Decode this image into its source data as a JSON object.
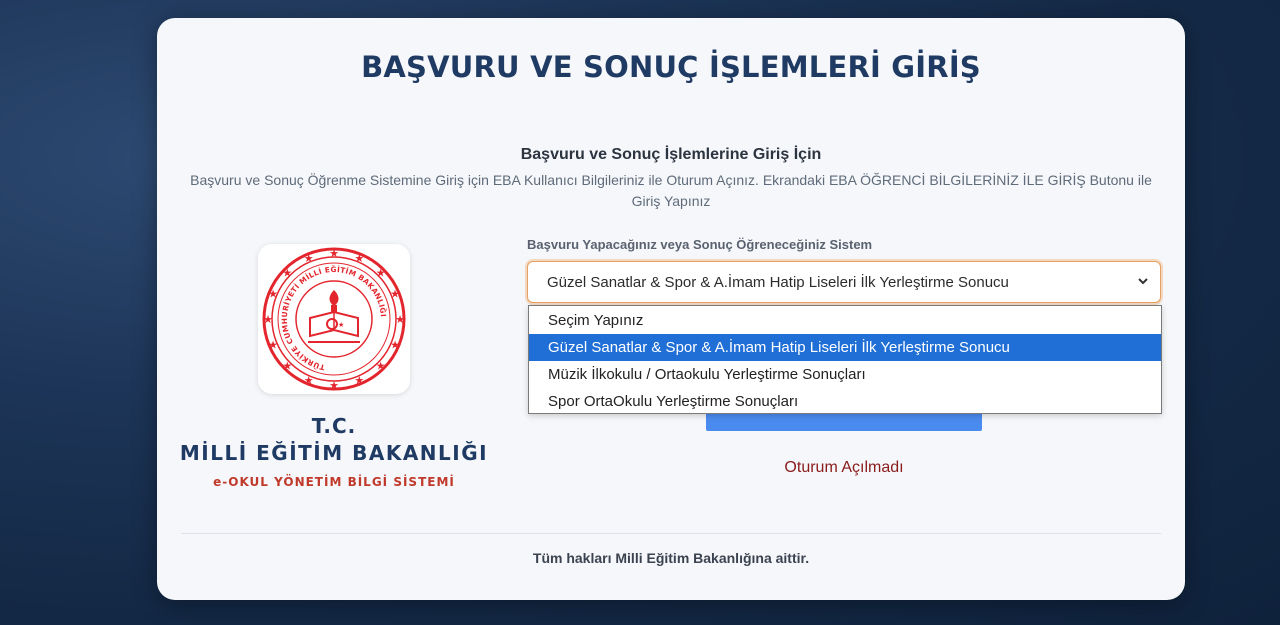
{
  "page": {
    "title": "BAŞVURU VE SONUÇ İŞLEMLERİ GİRİŞ",
    "subtitle": "Başvuru ve Sonuç İşlemlerine Giriş İçin",
    "info_line1": "Başvuru ve Sonuç Öğrenme Sistemine Giriş için EBA Kullanıcı Bilgileriniz ile Oturum Açınız. Ekrandaki EBA ÖĞRENCİ BİLGİLERİNİZ İLE GİRİŞ Butonu ile",
    "info_line2": "Giriş Yapınız"
  },
  "brand": {
    "line1": "T.C.",
    "line2": "MİLLİ EĞİTİM BAKANLIĞI",
    "line3": "e-OKUL YÖNETİM BİLGİ SİSTEMİ",
    "seal_text": "TÜRKİYE CUMHURİYETİ MİLLİ EĞİTİM BAKANLIĞI",
    "seal_color": "#e3262e"
  },
  "form": {
    "system_label": "Başvuru Yapacağınız veya Sonuç Öğreneceğiniz Sistem",
    "selected_value": "Güzel Sanatlar & Spor & A.İmam Hatip Liseleri İlk Yerleştirme Sonucu",
    "options": [
      "Seçim Yapınız",
      "Güzel Sanatlar & Spor & A.İmam Hatip Liseleri İlk Yerleştirme Sonucu",
      "Müzik İlkokulu / Ortaokulu Yerleştirme Sonuçları",
      "Spor OrtaOkulu Yerleştirme Sonuçları"
    ],
    "selected_index": 1,
    "status": "Oturum Açılmadı"
  },
  "footer": {
    "text": "Tüm hakları Milli Eğitim Bakanlığına aittir."
  },
  "colors": {
    "accent": "#1f3a63",
    "button": "#4a8bef",
    "highlight": "#1f6fd6",
    "status": "#8a1c1c",
    "focus_border": "#e8a062"
  }
}
